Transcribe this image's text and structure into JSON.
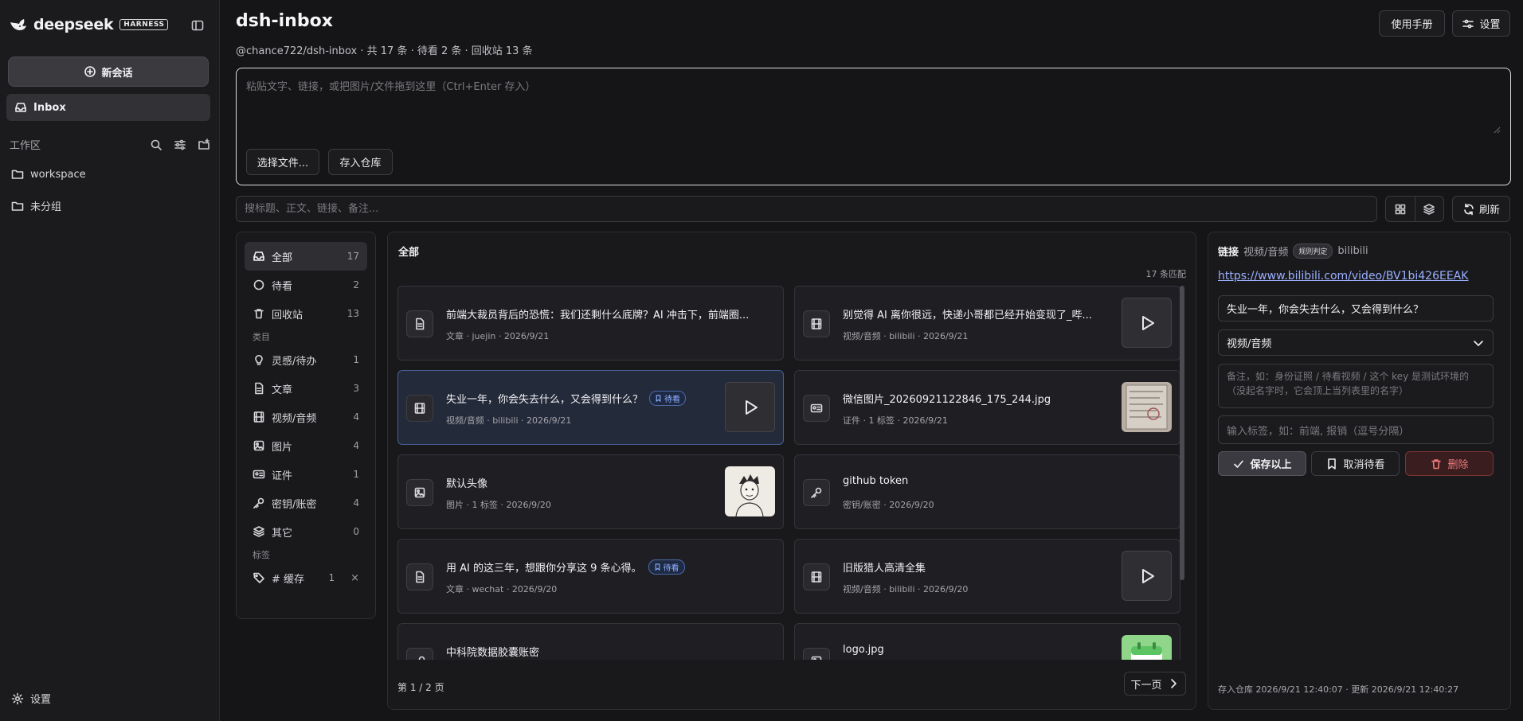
{
  "sidebar": {
    "logo_text": "deepseek",
    "harness_badge": "HARNESS",
    "new_chat": "新会话",
    "inbox": "Inbox",
    "workspace_label": "工作区",
    "folders": [
      "workspace",
      "未分组"
    ],
    "settings": "设置"
  },
  "header": {
    "title": "dsh-inbox",
    "subtitle": "@chance722/dsh-inbox · 共 17 条 · 待看 2 条 · 回收站 13 条",
    "manual_btn": "使用手册",
    "settings_btn": "设置"
  },
  "composer": {
    "placeholder": "粘贴文字、链接，或把图片/文件拖到这里（Ctrl+Enter 存入）",
    "choose_file": "选择文件...",
    "save_btn": "存入仓库"
  },
  "search": {
    "placeholder": "搜标题、正文、链接、备注...",
    "refresh": "刷新"
  },
  "filters": {
    "top": [
      {
        "label": "全部",
        "count": "17",
        "icon": "inbox-icon"
      },
      {
        "label": "待看",
        "count": "2",
        "icon": "circle-icon"
      },
      {
        "label": "回收站",
        "count": "13",
        "icon": "trash-icon"
      }
    ],
    "category_header": "类目",
    "categories": [
      {
        "label": "灵感/待办",
        "count": "1",
        "icon": "lightbulb-icon"
      },
      {
        "label": "文章",
        "count": "3",
        "icon": "document-icon"
      },
      {
        "label": "视频/音频",
        "count": "4",
        "icon": "film-icon"
      },
      {
        "label": "图片",
        "count": "4",
        "icon": "image-icon"
      },
      {
        "label": "证件",
        "count": "1",
        "icon": "id-card-icon"
      },
      {
        "label": "密钥/账密",
        "count": "4",
        "icon": "key-icon"
      },
      {
        "label": "其它",
        "count": "0",
        "icon": "layers-icon"
      }
    ],
    "tag_header": "标签",
    "tags": [
      {
        "label": "# 缓存",
        "count": "1",
        "remove": "×"
      }
    ]
  },
  "list": {
    "title": "全部",
    "match": "17 条匹配",
    "pending_badge": "待看",
    "items": [
      {
        "title": "前端大裁员背后的恐慌：我们还剩什么底牌？AI 冲击下，前端圈...",
        "meta": "文章 · juejin · 2026/9/21",
        "icon": "document-icon",
        "thumb": "none"
      },
      {
        "title": "别觉得 AI 离你很远，快递小哥都已经开始变现了_哔...",
        "meta": "视频/音频 · bilibili · 2026/9/21",
        "icon": "film-icon",
        "thumb": "play"
      },
      {
        "title": "失业一年，你会失去什么，又会得到什么？",
        "meta": "视频/音频 · bilibili · 2026/9/21",
        "icon": "film-icon",
        "thumb": "play",
        "pending": true,
        "selected": true
      },
      {
        "title": "微信图片_20260921122846_175_244.jpg",
        "meta": "证件 · 1 标签 · 2026/9/21",
        "icon": "id-card-icon",
        "thumb": "paper"
      },
      {
        "title": "默认头像",
        "meta": "图片 · 1 标签 · 2026/9/20",
        "icon": "image-icon",
        "thumb": "avatar"
      },
      {
        "title": "github token",
        "meta": "密钥/账密 · 2026/9/20",
        "icon": "key-icon",
        "thumb": "none"
      },
      {
        "title": "用 AI 的这三年，想跟你分享这 9 条心得。",
        "meta": "文章 · wechat · 2026/9/20",
        "icon": "document-icon",
        "thumb": "none",
        "pending": true
      },
      {
        "title": "旧版猎人高清全集",
        "meta": "视频/音频 · bilibili · 2026/9/20",
        "icon": "film-icon",
        "thumb": "play"
      },
      {
        "title": "中科院数据胶囊账密",
        "meta": "",
        "icon": "key-icon",
        "thumb": "none"
      },
      {
        "title": "logo.jpg",
        "meta": "",
        "icon": "image-icon",
        "thumb": "calendar"
      }
    ],
    "page_info": "第 1 / 2 页",
    "next_btn": "下一页"
  },
  "detail": {
    "type_link": "链接",
    "category": "视频/音频",
    "rule_badge": "规则判定",
    "source": "bilibili",
    "url": "https://www.bilibili.com/video/BV1bi426EEAK",
    "title_value": "失业一年，你会失去什么，又会得到什么？",
    "category_select": "视频/音频",
    "note_placeholder": "备注，如：身份证照 / 待看视频 / 这个 key 是测试环境的（没起名字时，它会顶上当列表里的名字）",
    "tags_placeholder": "输入标签，如：前端, 报销（逗号分隔）",
    "save_btn": "保存以上",
    "unpend_btn": "取消待看",
    "delete_btn": "删除",
    "footer": "存入仓库 2026/9/21 12:40:07 · 更新 2026/9/21 12:40:27"
  },
  "colors": {
    "accent_link": "#9ab0ff",
    "pending_badge": "#8fb0ff",
    "danger": "#e05a5a",
    "selected_card": "#232a3a"
  }
}
